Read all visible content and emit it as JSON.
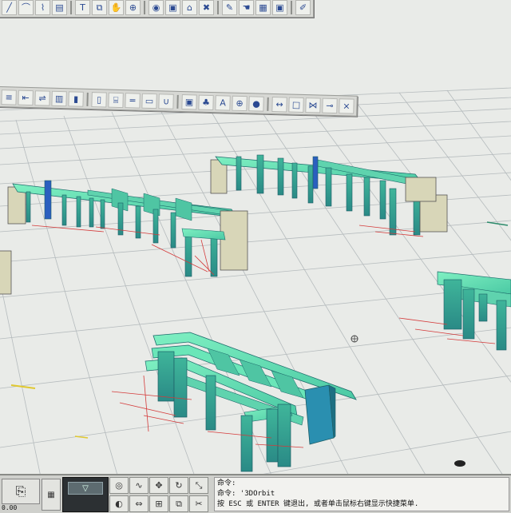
{
  "app": {
    "name": "AutoCAD 3D orbit view"
  },
  "colors": {
    "background": "#e9ebe8",
    "grid_line": "#b6bcbe",
    "beam_top": "#6fe0b4",
    "beam_side": "#2f9e8c",
    "beam_dark": "#1e6f82",
    "wall_panel": "#d8d6b8",
    "red_axis": "#d43a3a",
    "blue_accent": "#2b5fbf",
    "toolbar_bg": "#d7d8d4"
  },
  "toolbar_top": {
    "icons": [
      "line-icon",
      "arc-icon",
      "polyline-icon",
      "hatch-icon",
      "text-icon",
      "copy-icon",
      "pan-icon",
      "zoom-icon",
      "orbit-icon",
      "render-icon",
      "home-icon",
      "eraser-icon",
      "paint-icon",
      "hand-icon",
      "grid-icon",
      "properties-icon",
      "brush-icon"
    ]
  },
  "toolbar_draw": {
    "icons": [
      "layer-icon",
      "layer-prev-icon",
      "match-icon",
      "table-icon",
      "column-icon",
      "wall-icon",
      "stair-icon",
      "beam-icon",
      "slab-icon",
      "u-profile-icon",
      "block-icon",
      "tree-icon",
      "text-a-icon",
      "target-icon",
      "sphere-icon",
      "dimension-icon",
      "panel-icon",
      "truss-icon",
      "node-icon",
      "close-icon"
    ]
  },
  "command": {
    "history_label": "命令:",
    "last_prompt": "命令: '3DOrbit",
    "hint": "按 ESC 或 ENTER 键退出, 或者单击鼠标右键显示快捷菜单."
  },
  "statusbar": {
    "coord": "0.00"
  }
}
